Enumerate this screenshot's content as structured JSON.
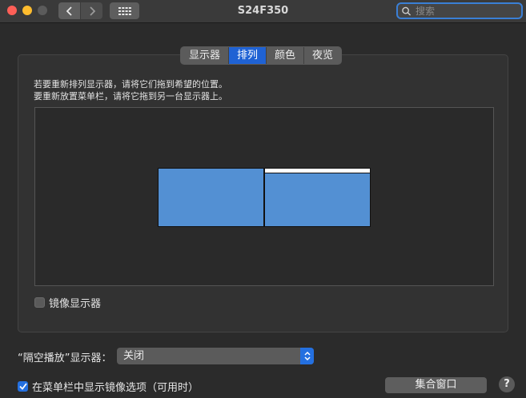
{
  "window": {
    "title": "S24F350",
    "search_placeholder": "搜索"
  },
  "tabs": [
    {
      "label": "显示器",
      "active": false
    },
    {
      "label": "排列",
      "active": true
    },
    {
      "label": "颜色",
      "active": false
    },
    {
      "label": "夜览",
      "active": false
    }
  ],
  "arrangement": {
    "instruction_line1": "若要重新排列显示器，请将它们拖到希望的位置。",
    "instruction_line2": "要重新放置菜单栏，请将它拖到另一台显示器上。",
    "display_color": "#5390d3",
    "mirror_label": "镜像显示器",
    "mirror_checked": false
  },
  "airplay": {
    "label": "“隔空播放”显示器：",
    "selected": "关闭"
  },
  "footer": {
    "menu_option_label": "在菜单栏中显示镜像选项（可用时）",
    "menu_option_checked": true,
    "gather_button": "集合窗口",
    "help": "?"
  },
  "colors": {
    "accent": "#2470e0",
    "background": "#2b2b2b"
  }
}
